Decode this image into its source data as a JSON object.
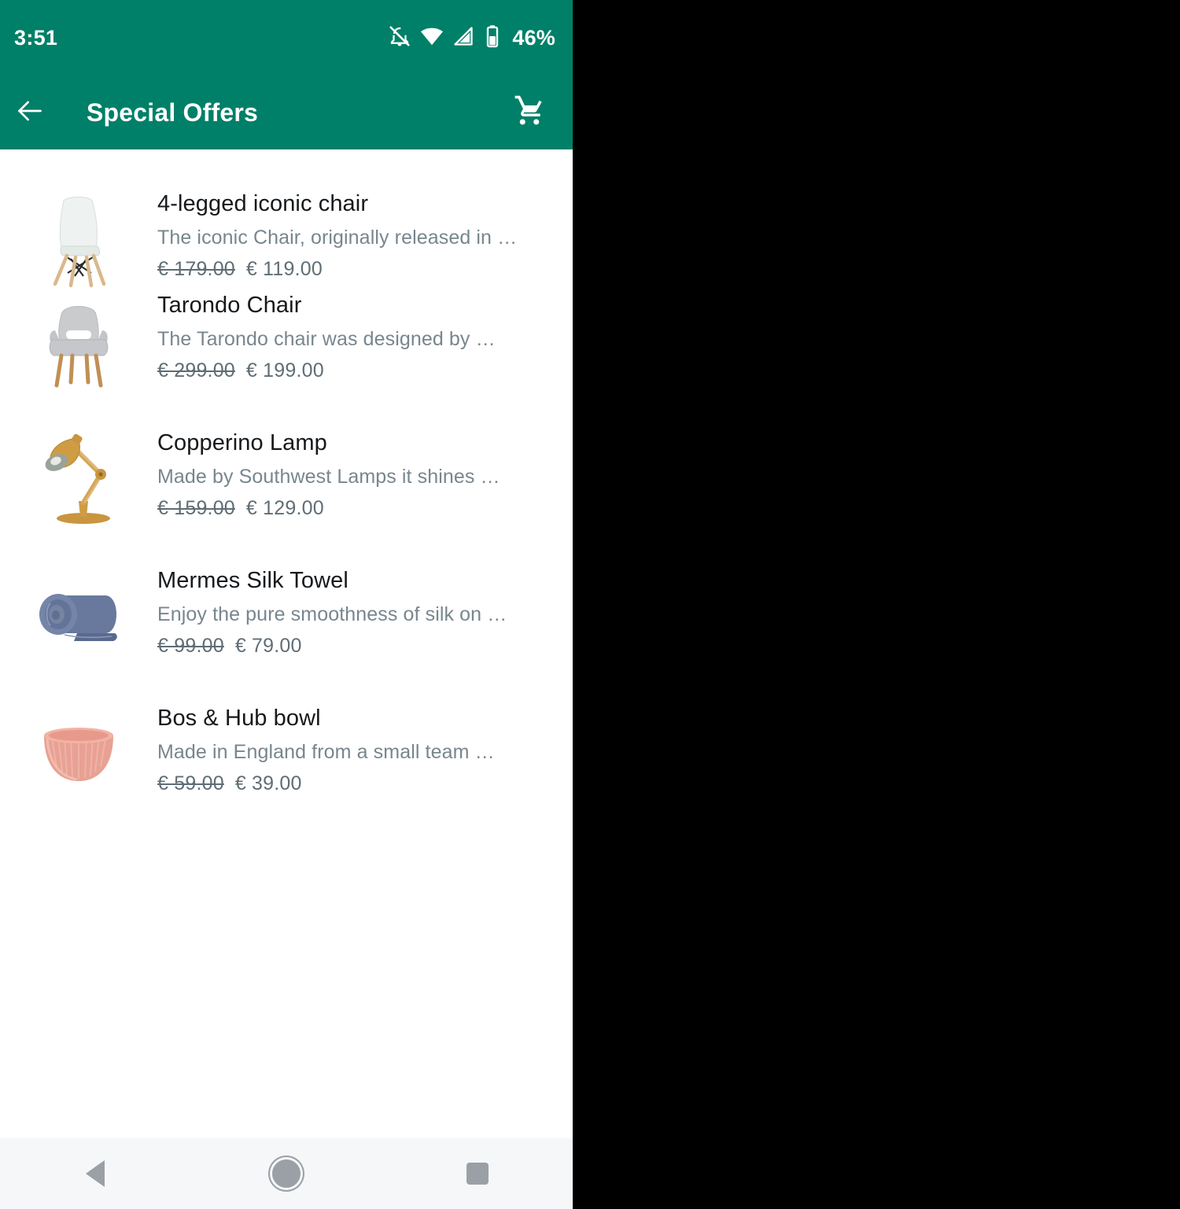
{
  "status_bar": {
    "clock": "3:51",
    "battery_percent": "46%",
    "icons": [
      "notifications-off-icon",
      "wifi-icon",
      "signal-icon",
      "battery-icon"
    ]
  },
  "app_bar": {
    "back_label": "back-arrow",
    "title": "Special Offers",
    "cart_label": "shopping-cart"
  },
  "theme": {
    "primary": "#008068",
    "title_color": "#16191c",
    "desc_color": "#78868e",
    "price_color": "#5f6d75",
    "nav_bg": "#f5f7f8",
    "nav_icon": "#9aa0a6"
  },
  "products": [
    {
      "title": "4-legged iconic chair",
      "description": "The iconic Chair, originally released in …",
      "price_old": "€ 179.00",
      "price_new": "€ 119.00",
      "thumb": "white-eames-chair-image"
    },
    {
      "title": "Tarondo Chair",
      "description": "The Tarondo chair was designed by …",
      "price_old": "€ 299.00",
      "price_new": "€ 199.00",
      "thumb": "grey-armchair-image"
    },
    {
      "title": "Copperino Lamp",
      "description": "Made by Southwest Lamps it shines …",
      "price_old": "€ 159.00",
      "price_new": "€ 129.00",
      "thumb": "copper-desk-lamp-image"
    },
    {
      "title": "Mermes Silk Towel",
      "description": "Enjoy the pure smoothness of silk on …",
      "price_old": "€ 99.00",
      "price_new": "€ 79.00",
      "thumb": "blue-rolled-towel-image"
    },
    {
      "title": "Bos & Hub bowl",
      "description": "Made in England from a small team …",
      "price_old": "€ 59.00",
      "price_new": "€ 39.00",
      "thumb": "pink-ribbed-bowl-image"
    }
  ],
  "nav_bar": {
    "buttons": [
      "back-nav-button",
      "home-nav-button",
      "recents-nav-button"
    ]
  }
}
